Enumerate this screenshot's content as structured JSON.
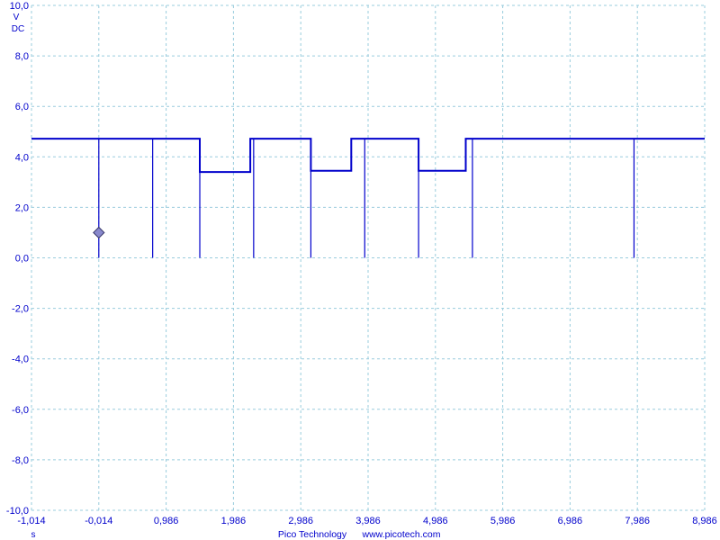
{
  "chart_data": {
    "type": "line",
    "title": "",
    "x_unit": "s",
    "y_unit": "V",
    "y_coupling": "DC",
    "xlim": [
      -1.014,
      8.986
    ],
    "ylim": [
      -10,
      10
    ],
    "grid": true,
    "x_tick_labels": [
      "-1,014",
      "-0,014",
      "0,986",
      "1,986",
      "2,986",
      "3,986",
      "4,986",
      "5,986",
      "6,986",
      "7,986",
      "8,986"
    ],
    "y_tick_labels": [
      "10,0",
      "8,0",
      "6,0",
      "4,0",
      "2,0",
      "0,0",
      "-2,0",
      "-4,0",
      "-6,0",
      "-8,0",
      "-10,0"
    ],
    "series": [
      {
        "color": "#0000cc",
        "x": [
          -1.014,
          1.486,
          1.486,
          2.236,
          2.236,
          3.136,
          3.136,
          3.736,
          3.736,
          4.736,
          4.736,
          5.436,
          5.436,
          8.986
        ],
        "y": [
          4.72,
          4.72,
          3.4,
          3.4,
          4.72,
          4.72,
          3.45,
          3.45,
          4.72,
          4.72,
          3.45,
          3.45,
          4.72,
          4.72
        ]
      }
    ],
    "spikes": [
      {
        "x": -0.014,
        "y_top": 4.72,
        "y_bottom": 0.0
      },
      {
        "x": 0.786,
        "y_top": 4.72,
        "y_bottom": 0.0
      },
      {
        "x": 1.486,
        "y_top": 3.4,
        "y_bottom": 0.0
      },
      {
        "x": 2.286,
        "y_top": 4.72,
        "y_bottom": 0.0
      },
      {
        "x": 3.136,
        "y_top": 4.72,
        "y_bottom": 0.0
      },
      {
        "x": 3.936,
        "y_top": 4.72,
        "y_bottom": 0.0
      },
      {
        "x": 4.736,
        "y_top": 4.72,
        "y_bottom": 0.0
      },
      {
        "x": 5.536,
        "y_top": 4.72,
        "y_bottom": 0.0
      },
      {
        "x": 7.936,
        "y_top": 4.72,
        "y_bottom": 0.0
      }
    ],
    "trigger_marker": {
      "x": -0.014,
      "y": 1.0
    }
  },
  "footer": {
    "brand": "Pico Technology",
    "url": "www.picotech.com"
  },
  "colors": {
    "trace": "#0000cc",
    "grid": "#99ccdd",
    "marker": "#8888cc"
  }
}
